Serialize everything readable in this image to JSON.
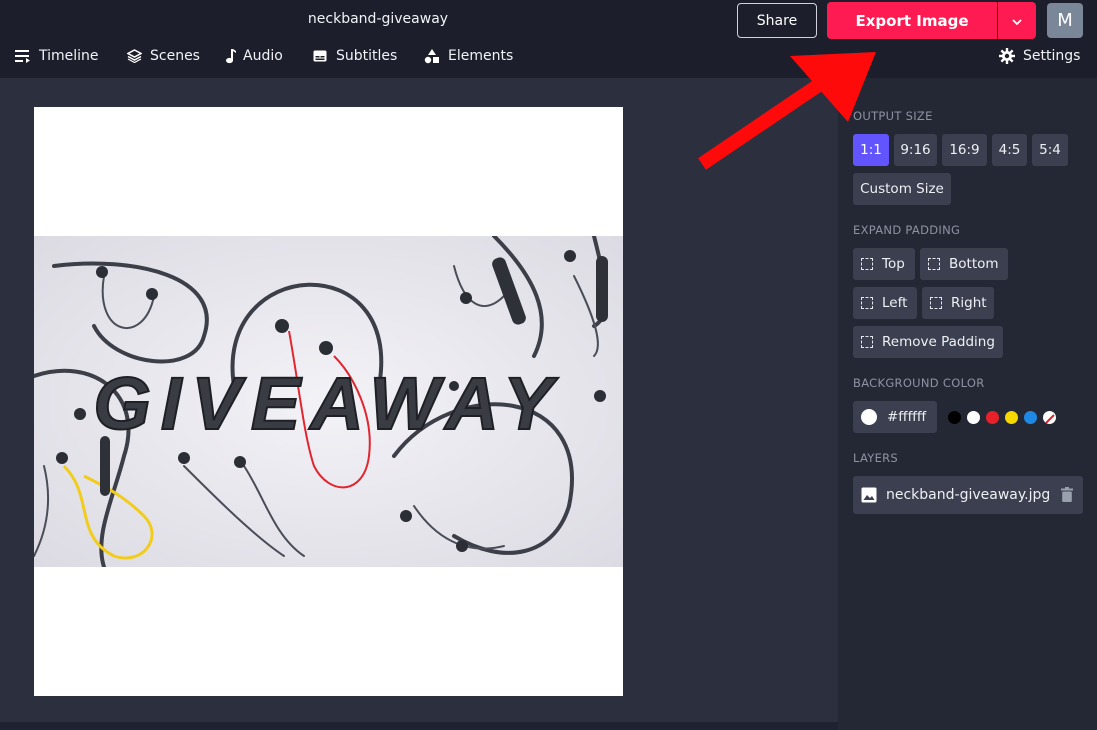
{
  "header": {
    "project_title": "neckband-giveaway",
    "share_label": "Share",
    "export_label": "Export Image",
    "avatar_initial": "M",
    "accent_color": "#fe1b52"
  },
  "menu": {
    "items": [
      {
        "label": "Timeline",
        "icon": "timeline-icon"
      },
      {
        "label": "Scenes",
        "icon": "layers-icon"
      },
      {
        "label": "Audio",
        "icon": "music-note-icon"
      },
      {
        "label": "Subtitles",
        "icon": "subtitles-icon"
      },
      {
        "label": "Elements",
        "icon": "shapes-icon"
      }
    ],
    "settings_label": "Settings"
  },
  "canvas": {
    "overlay_text": "GIVEAWAY",
    "background_color": "#ffffff"
  },
  "panel": {
    "output_size_label": "OUTPUT SIZE",
    "sizes": [
      "1:1",
      "9:16",
      "16:9",
      "4:5",
      "5:4"
    ],
    "active_size": "1:1",
    "custom_size_label": "Custom Size",
    "expand_padding_label": "EXPAND PADDING",
    "padding": {
      "top": "Top",
      "bottom": "Bottom",
      "left": "Left",
      "right": "Right",
      "remove": "Remove Padding"
    },
    "background_color_label": "BACKGROUND COLOR",
    "background_hex": "#ffffff",
    "preset_colors": [
      "#000000",
      "#ffffff",
      "#e8202a",
      "#f5d800",
      "#1e88e5",
      "transparent"
    ],
    "layers_label": "LAYERS",
    "layers": [
      {
        "name": "neckband-giveaway.jpg"
      }
    ]
  }
}
